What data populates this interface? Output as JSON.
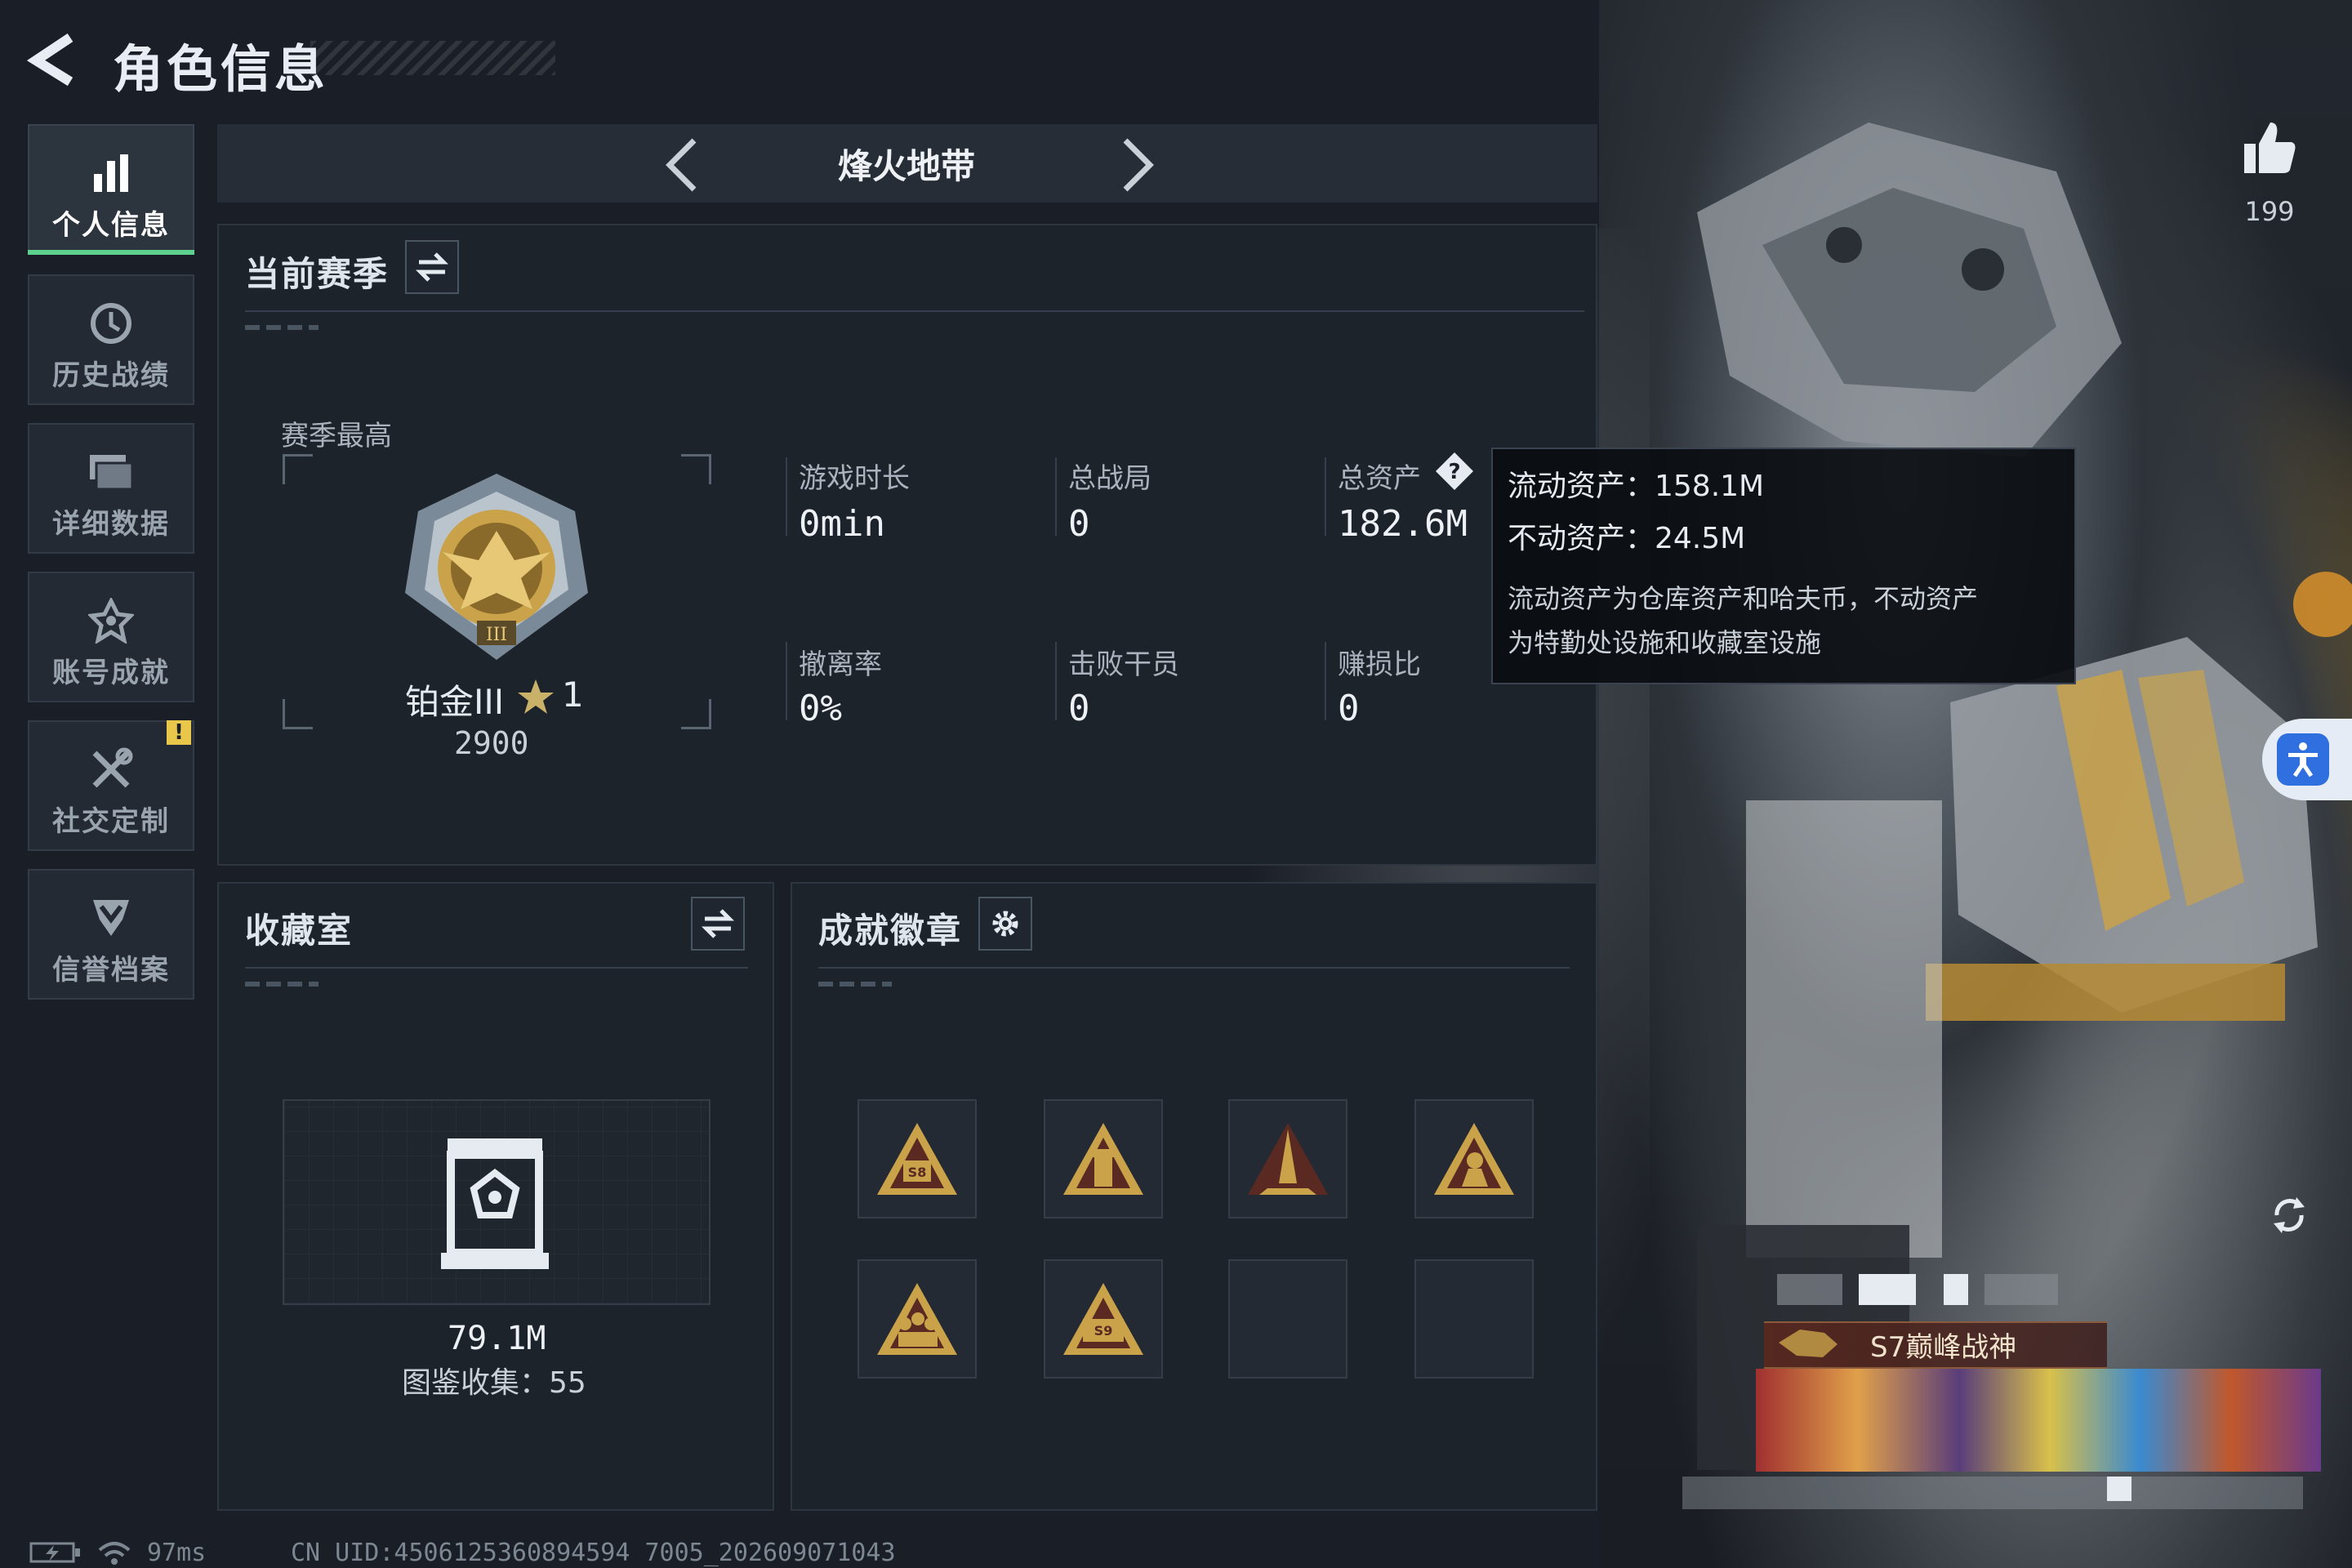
{
  "header": {
    "title": "角色信息"
  },
  "sidebar": {
    "items": [
      {
        "label": "个人信息",
        "icon": "bar-chart-icon",
        "active": true
      },
      {
        "label": "历史战绩",
        "icon": "history-clock-icon"
      },
      {
        "label": "详细数据",
        "icon": "folder-stack-icon"
      },
      {
        "label": "账号成就",
        "icon": "achievement-star-icon"
      },
      {
        "label": "社交定制",
        "icon": "tools-crossed-icon",
        "badge": "!"
      },
      {
        "label": "信誉档案",
        "icon": "shield-chevron-icon"
      }
    ]
  },
  "mode": {
    "label": "烽火地带"
  },
  "season": {
    "title": "当前赛季",
    "best_label": "赛季最高",
    "rank_name": "铂金III",
    "rank_stars": "1",
    "rank_score": "2900",
    "stats": [
      {
        "label": "游戏时长",
        "value": "0min"
      },
      {
        "label": "总战局",
        "value": "0"
      },
      {
        "label": "总资产",
        "value": "182.6M"
      },
      {
        "label": "撤离率",
        "value": "0%"
      },
      {
        "label": "击败干员",
        "value": "0"
      },
      {
        "label": "赚损比",
        "value": "0"
      }
    ]
  },
  "tooltip": {
    "liquid": "流动资产：158.1M",
    "fixed": "不动资产：24.5M",
    "desc1": "流动资产为仓库资产和哈夫币，不动资产",
    "desc2": "为特勤处设施和收藏室设施"
  },
  "collection": {
    "title": "收藏室",
    "value": "79.1M",
    "collect_text": "图鉴收集：55"
  },
  "badges": {
    "title": "成就徽章",
    "items": [
      {
        "name": "badge-s8-icon",
        "text": "S8"
      },
      {
        "name": "badge-tower-icon",
        "text": ""
      },
      {
        "name": "badge-rocket-icon",
        "text": ""
      },
      {
        "name": "badge-operator-icon",
        "text": ""
      },
      {
        "name": "badge-squad-icon",
        "text": ""
      },
      {
        "name": "badge-s9-icon",
        "text": "S9"
      }
    ]
  },
  "profile": {
    "likes": "199",
    "title_plate": "S7巅峰战神"
  },
  "status": {
    "ping": "97ms",
    "uid": "CN UID:4506125360894594 7005_202609071043"
  },
  "colors": {
    "accent_green": "#5fd18e",
    "badge_gold": "#c9a24a",
    "alert_yellow": "#e9c74a"
  }
}
